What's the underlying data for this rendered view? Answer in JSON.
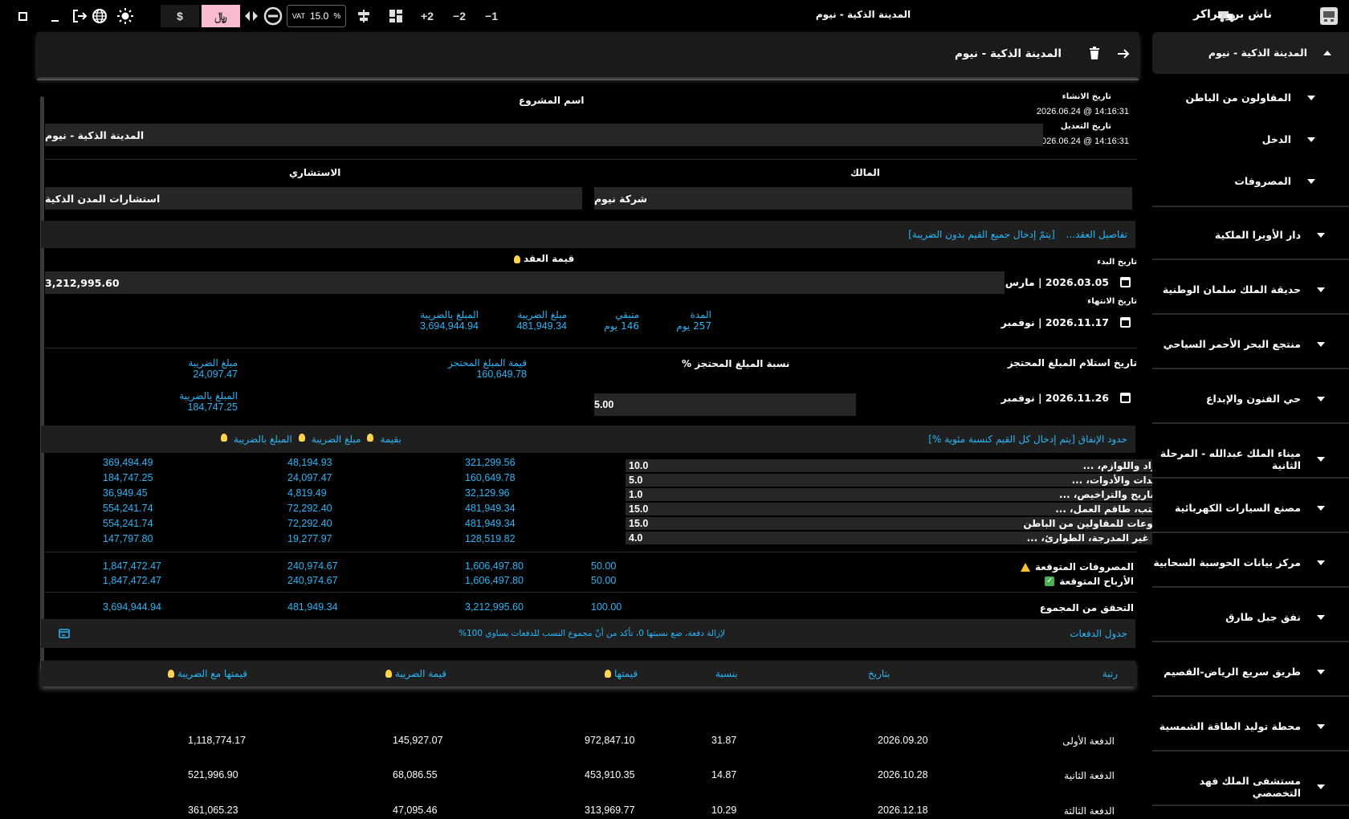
{
  "app": {
    "title": "ناش برو تراكر",
    "window_title": "المدينة الذكية - نيوم"
  },
  "toolbar": {
    "minus1": "−1",
    "minus2": "−2",
    "plus2": "+2",
    "vat_label": "VAT",
    "vat_value": "15.0",
    "vat_unit": "%",
    "currency_dollar": "$",
    "currency_riyal": "﷼"
  },
  "header": {
    "title": "المدينة الذكية - نيوم"
  },
  "meta": {
    "created_label": "تاريخ الانشاء",
    "created_value": "2026.06.24 @ 14:16:31",
    "modified_label": "تاريخ التعديل",
    "modified_value": "2026.06.24 @ 14:16:31"
  },
  "project": {
    "name_label": "اسم المشروع",
    "name_value": "المدينة الذكية - نيوم",
    "owner_label": "المالك",
    "owner_value": "شركة نيوم",
    "consultant_label": "الاستشاري",
    "consultant_value": "استشارات المدن الذكية"
  },
  "contract": {
    "band_title": "تفاصيل العقد...",
    "band_note": "[يتمّ إدخال جميع القيم بدون الضريبة]",
    "start_label": "تاريخ البدء",
    "start_value": "2026.03.05 | مارس",
    "value_label": "قيمة العقد",
    "value": "3,212,995.60",
    "end_label": "تاريخ الانتهاء",
    "end_value": "2026.11.17 | نوفمبر",
    "duration_label": "المدة",
    "duration_value": "257 يوم",
    "remaining_label": "متبقي",
    "remaining_value": "146 يوم",
    "tax_label": "مبلغ الضريبة",
    "tax_value": "481,949.34",
    "with_tax_label": "المبلغ بالضريبة",
    "with_tax_value": "3,694,944.94"
  },
  "retention": {
    "date_label": "تاريخ استلام المبلغ المحتجز",
    "date_value": "2026.11.26 | نوفمبر",
    "pct_label": "نسبة المبلغ المحتجز %",
    "pct_value": "5.00",
    "amount_label": "قيمة المبلغ المحتجز",
    "amount_value": "160,649.78",
    "tax_label": "مبلغ الضريبة",
    "tax_value": "24,097.47",
    "with_tax_label": "المبلغ بالضريبة",
    "with_tax_value": "184,747.25"
  },
  "spending": {
    "band_title": "حدود الإنفاق [يتم إدخال كل القيم كنسبة مئوية %]",
    "col_value": "بقيمة",
    "col_tax": "مبلغ الضريبة",
    "col_with_tax": "المبلغ بالضريبة",
    "rows": [
      {
        "label": "المواد واللوازم، ...",
        "pct": "10.0",
        "value": "321,299.56",
        "tax": "48,194.93",
        "total": "369,494.49"
      },
      {
        "label": "المعدات والأدوات، ...",
        "pct": "5.0",
        "value": "160,649.78",
        "tax": "24,097.47",
        "total": "184,747.25"
      },
      {
        "label": "التصاريح والتراخيص، ...",
        "pct": "1.0",
        "value": "32,129.96",
        "tax": "4,819.49",
        "total": "36,949.45"
      },
      {
        "label": "المكتب، طاقم العمل، ...",
        "pct": "15.0",
        "value": "481,949.34",
        "tax": "72,292.40",
        "total": "554,241.74"
      },
      {
        "label": "مدفوعات للمقاولين من الباطن",
        "pct": "15.0",
        "value": "481,949.34",
        "tax": "72,292.40",
        "total": "554,241.74"
      },
      {
        "label": "بنود غير المدرجة، الطوارئ، ...",
        "pct": "4.0",
        "value": "128,519.82",
        "tax": "19,277.97",
        "total": "147,797.80"
      }
    ],
    "expected_expenses_label": "المصروفات المتوقعة",
    "expected_expenses": {
      "pct": "50.00",
      "value": "1,606,497.80",
      "tax": "240,974.67",
      "total": "1,847,472.47"
    },
    "expected_profit_label": "الأرباح المتوقعة",
    "expected_profit": {
      "pct": "50.00",
      "value": "1,606,497.80",
      "tax": "240,974.67",
      "total": "1,847,472.47"
    },
    "check_label": "التحقق من المجموع",
    "check": {
      "pct": "100.00",
      "value": "3,212,995.60",
      "tax": "481,949.34",
      "total": "3,694,944.94"
    }
  },
  "payments": {
    "band_title": "جدول الدفعات",
    "band_note": "لإزالة دفعة، ضع نسبتها 0، تأكد من أنّ مجموع النسب للدفعات يساوي 100%",
    "col_rank": "رتبة",
    "col_date": "بتاريخ",
    "col_pct": "بنسبة",
    "col_value": "قيمتها",
    "col_tax": "قيمة الضريبة",
    "col_with_tax": "قيمتها مع الضريبة",
    "rows": [
      {
        "rank": "الدفعة الأولى",
        "date": "2026.09.20",
        "pct": "31.87",
        "value": "972,847.10",
        "tax": "145,927.07",
        "total": "1,118,774.17"
      },
      {
        "rank": "الدفعة الثانية",
        "date": "2026.10.28",
        "pct": "14.87",
        "value": "453,910.35",
        "tax": "68,086.55",
        "total": "521,996.90"
      },
      {
        "rank": "الدفعة الثالثة",
        "date": "2026.12.18",
        "pct": "10.29",
        "value": "313,969.77",
        "tax": "47,095.46",
        "total": "361,065.23"
      }
    ]
  },
  "sidebar": {
    "active_label": "المدينة الذكية - نيوم",
    "sub_items": [
      "المقاولون من الباطن",
      "الدخل",
      "المصروفات"
    ],
    "projects": [
      "دار الأوبرا الملكية",
      "حديقة الملك سلمان الوطنية",
      "منتجع البحر الأحمر السياحي",
      "حي الفنون والإبداع",
      "ميناء الملك عبدالله - المرحلة الثانية",
      "مصنع السيارات الكهربائية",
      "مركز بيانات الحوسبة السحابية",
      "نفق جبل طارق",
      "طريق سريع الرياض-القصيم",
      "محطة توليد الطاقة الشمسية",
      "مستشفى الملك فهد التخصصي"
    ]
  },
  "colors": {
    "accent": "#29b6f6",
    "active_currency_bg": "#f8bbd0",
    "warning": "#fbc02d",
    "ok": "#4caf50"
  }
}
